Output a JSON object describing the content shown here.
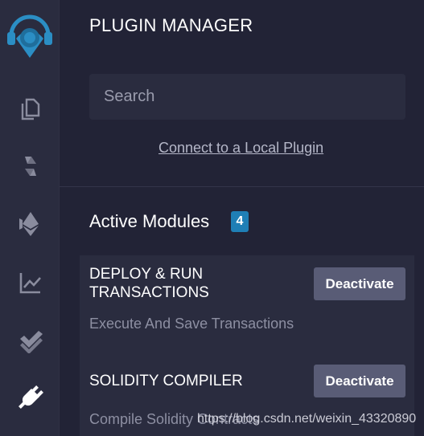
{
  "sidebar": {
    "icons": [
      {
        "name": "logo-icon"
      },
      {
        "name": "file-explorer-icon"
      },
      {
        "name": "solidity-compiler-icon"
      },
      {
        "name": "deploy-run-icon"
      },
      {
        "name": "analysis-icon"
      },
      {
        "name": "testing-icon"
      },
      {
        "name": "plugin-manager-icon"
      }
    ],
    "icon_color": "#8a8c9e",
    "active_icon_color": "#ffffff",
    "logo_color": "#2b8ec4"
  },
  "panel": {
    "title": "PLUGIN MANAGER",
    "search_placeholder": "Search",
    "local_plugin_link": "Connect to a Local Plugin",
    "section_title": "Active Modules",
    "active_count": "4"
  },
  "modules": [
    {
      "name": "DEPLOY & RUN TRANSACTIONS",
      "description": "Execute And Save Transactions",
      "button": "Deactivate"
    },
    {
      "name": "SOLIDITY COMPILER",
      "description": "Compile Solidity Contracts",
      "button": "Deactivate"
    }
  ],
  "watermark": "https://blog.csdn.net/weixin_43320890"
}
